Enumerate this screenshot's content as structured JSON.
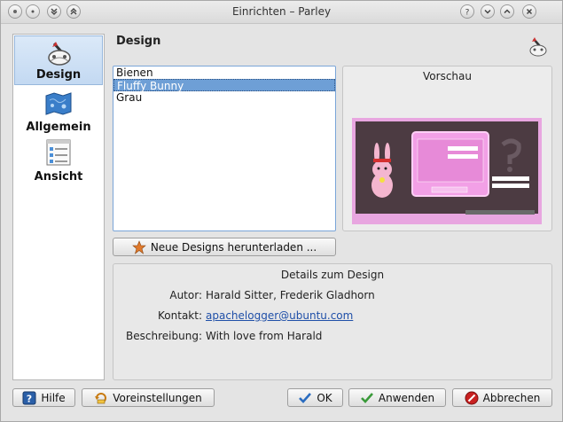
{
  "window": {
    "title": "Einrichten – Parley"
  },
  "sidebar": {
    "items": [
      {
        "label": "Design",
        "icon": "design-icon",
        "selected": true
      },
      {
        "label": "Allgemein",
        "icon": "general-icon",
        "selected": false
      },
      {
        "label": "Ansicht",
        "icon": "view-icon",
        "selected": false
      }
    ]
  },
  "page": {
    "title": "Design",
    "header_icon": "design-icon"
  },
  "themes": {
    "items": [
      "Bienen",
      "Fluffy Bunny",
      "Grau"
    ],
    "selected": "Fluffy Bunny"
  },
  "preview": {
    "title": "Vorschau"
  },
  "download_button": {
    "label": "Neue Designs herunterladen ..."
  },
  "details": {
    "title": "Details zum Design",
    "author_label": "Autor:",
    "author": "Harald Sitter, Frederik Gladhorn",
    "contact_label": "Kontakt:",
    "contact": "apachelogger@ubuntu.com",
    "description_label": "Beschreibung:",
    "description": "With love from Harald"
  },
  "buttons": {
    "help": "Hilfe",
    "defaults": "Voreinstellungen",
    "ok": "OK",
    "apply": "Anwenden",
    "cancel": "Abbrechen"
  },
  "colors": {
    "selection": "#6e9fd6",
    "link": "#1f4fa8",
    "preview_bg": "#4a3a40",
    "preview_pink": "#e89ad8"
  }
}
